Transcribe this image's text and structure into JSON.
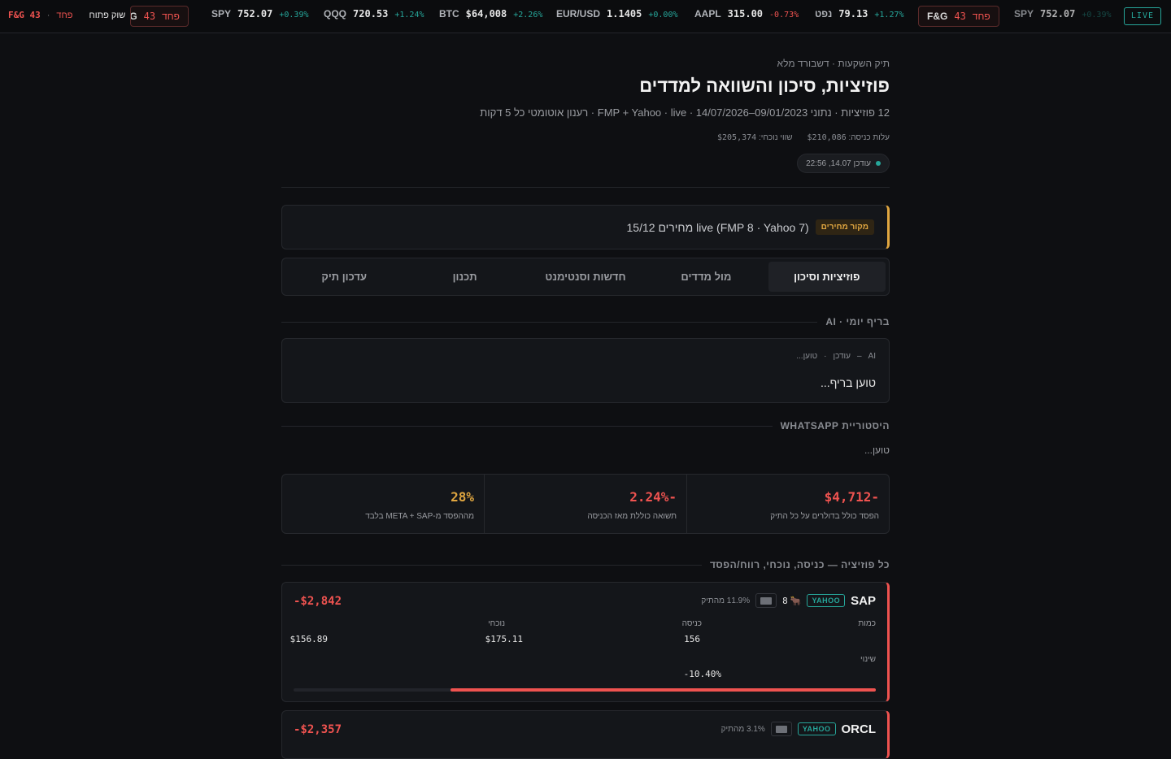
{
  "ticker": {
    "market_status": "שוק פתוח",
    "fg_mini_label": "F&G 43",
    "fg_mini_word": "פחד",
    "fg_chip_left": {
      "label": "F&G",
      "value": "43",
      "word": "פחד"
    },
    "fg_chip_right": {
      "label": "F&G",
      "value": "43",
      "word": "פחד"
    },
    "items": [
      {
        "symbol": "SPY",
        "price": "752.07",
        "change": "+0.39%",
        "dir": "up"
      },
      {
        "symbol": "QQQ",
        "price": "720.53",
        "change": "+1.24%",
        "dir": "up"
      },
      {
        "symbol": "BTC",
        "price": "$64,008",
        "change": "+2.26%",
        "dir": "up"
      },
      {
        "symbol": "EUR/USD",
        "price": "1.1405",
        "change": "+0.00%",
        "dir": "up"
      },
      {
        "symbol": "AAPL",
        "price": "315.00",
        "change": "-0.73%",
        "dir": "dn"
      },
      {
        "symbol": "נפט",
        "price": "79.13",
        "change": "+1.27%",
        "dir": "up"
      },
      {
        "symbol": "SPY",
        "price": "752.07",
        "change": "+0.39%",
        "dir": "up"
      }
    ],
    "live_label": "LIVE"
  },
  "header": {
    "breadcrumb": "תיק השקעות · דשבורד מלא",
    "title": "פוזיציות, סיכון והשוואה למדדים",
    "subtitle": "12 פוזיציות · נתוני 09/01/2023–14/07/2026 · FMP + Yahoo · live · רענון אוטומטי כל 5 דקות",
    "entry_cost_label": "עלות כניסה:",
    "entry_cost_value": "$210,086",
    "current_value_label": "שווי נוכחי:",
    "current_value_value": "$205,374",
    "updated": "עודכן 14.07, 22:56"
  },
  "source": {
    "badge": "מקור מחירים",
    "text": "live (FMP 8 · Yahoo 7) מחירים 15/12"
  },
  "tabs": [
    {
      "label": "פוזיציות וסיכון",
      "active": true
    },
    {
      "label": "מול מדדים",
      "active": false
    },
    {
      "label": "חדשות וסנטימנט",
      "active": false
    },
    {
      "label": "תכנון",
      "active": false
    },
    {
      "label": "עדכון תיק",
      "active": false
    }
  ],
  "brief": {
    "section_title": "בריף יומי · AI",
    "meta_ai": "AI",
    "meta_dash": "–",
    "meta_updated": "עודכן",
    "meta_dot": "·",
    "meta_loading": "טוען...",
    "body": "טוען בריף..."
  },
  "whatsapp": {
    "section_title": "היסטוריית WHATSAPP",
    "loading": "טוען..."
  },
  "stats": [
    {
      "value": "-$4,712",
      "caption": "הפסד כולל בדולרים על כל התיק",
      "color": "#ef5350"
    },
    {
      "value": "-2.24%",
      "caption": "תשואה כוללת מאז הכניסה",
      "color": "#ef5350"
    },
    {
      "value": "28%",
      "caption": "מההפסד מ-META + SAP בלבד",
      "color": "#e0a640"
    }
  ],
  "positions_section_title": "כל פוזיציה — כניסה, נוכחי, רווח/הפסד",
  "positions": [
    {
      "symbol": "SAP",
      "source": "YAHOO",
      "group_count": "8",
      "group_icon": "bull-icon",
      "weight": "11.9% מהתיק",
      "pnl": "-$2,842",
      "qty_label": "כמות",
      "qty": "156",
      "entry_label": "כניסה",
      "entry": "$175.11",
      "current_label": "נוכחי",
      "current": "$156.89",
      "change_label": "שינוי",
      "change": "-10.40%",
      "bar_fraction": 0.73
    },
    {
      "symbol": "ORCL",
      "source": "YAHOO",
      "weight": "3.1% מהתיק",
      "pnl": "-$2,357"
    }
  ]
}
